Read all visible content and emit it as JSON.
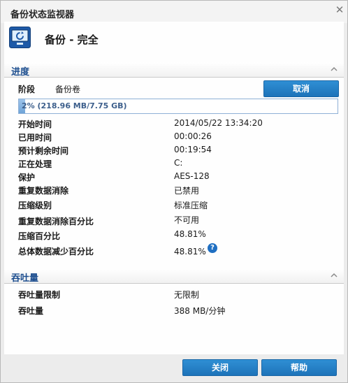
{
  "window": {
    "title": "备份状态监视器",
    "close_glyph": "✕"
  },
  "header": {
    "status_title": "备份 - 完全",
    "icon": "backup-monitor-icon"
  },
  "progress_section": {
    "title": "进度",
    "stage_label": "阶段",
    "stage_value": "备份卷",
    "cancel_label": "取消",
    "progress": {
      "fraction": 0.02,
      "text": "2% (218.96 MB/7.75 GB)"
    },
    "rows": [
      {
        "label": "开始时间",
        "value": "2014/05/22 13:34:20"
      },
      {
        "label": "已用时间",
        "value": "00:00:26"
      },
      {
        "label": "预计剩余时间",
        "value": "00:19:54"
      },
      {
        "label": "正在处理",
        "value": "C:"
      },
      {
        "label": "保护",
        "value": "AES-128"
      },
      {
        "label": "重复数据消除",
        "value": "已禁用"
      },
      {
        "label": "压缩级别",
        "value": "标准压缩"
      },
      {
        "label": "重复数据消除百分比",
        "value": "不可用"
      },
      {
        "label": "压缩百分比",
        "value": "48.81%"
      },
      {
        "label": "总体数据减少百分比",
        "value": "48.81%"
      }
    ],
    "help_glyph": "?"
  },
  "throughput_section": {
    "title": "吞吐量",
    "rows": [
      {
        "label": "吞吐量限制",
        "value": "无限制"
      },
      {
        "label": "吞吐量",
        "value": "388 MB/分钟"
      }
    ]
  },
  "footer": {
    "close_label": "关闭",
    "help_label": "帮助"
  },
  "colors": {
    "accent": "#1d73b9",
    "section_title": "#1d4e8f",
    "progress_fill": "#6fa4d8"
  }
}
